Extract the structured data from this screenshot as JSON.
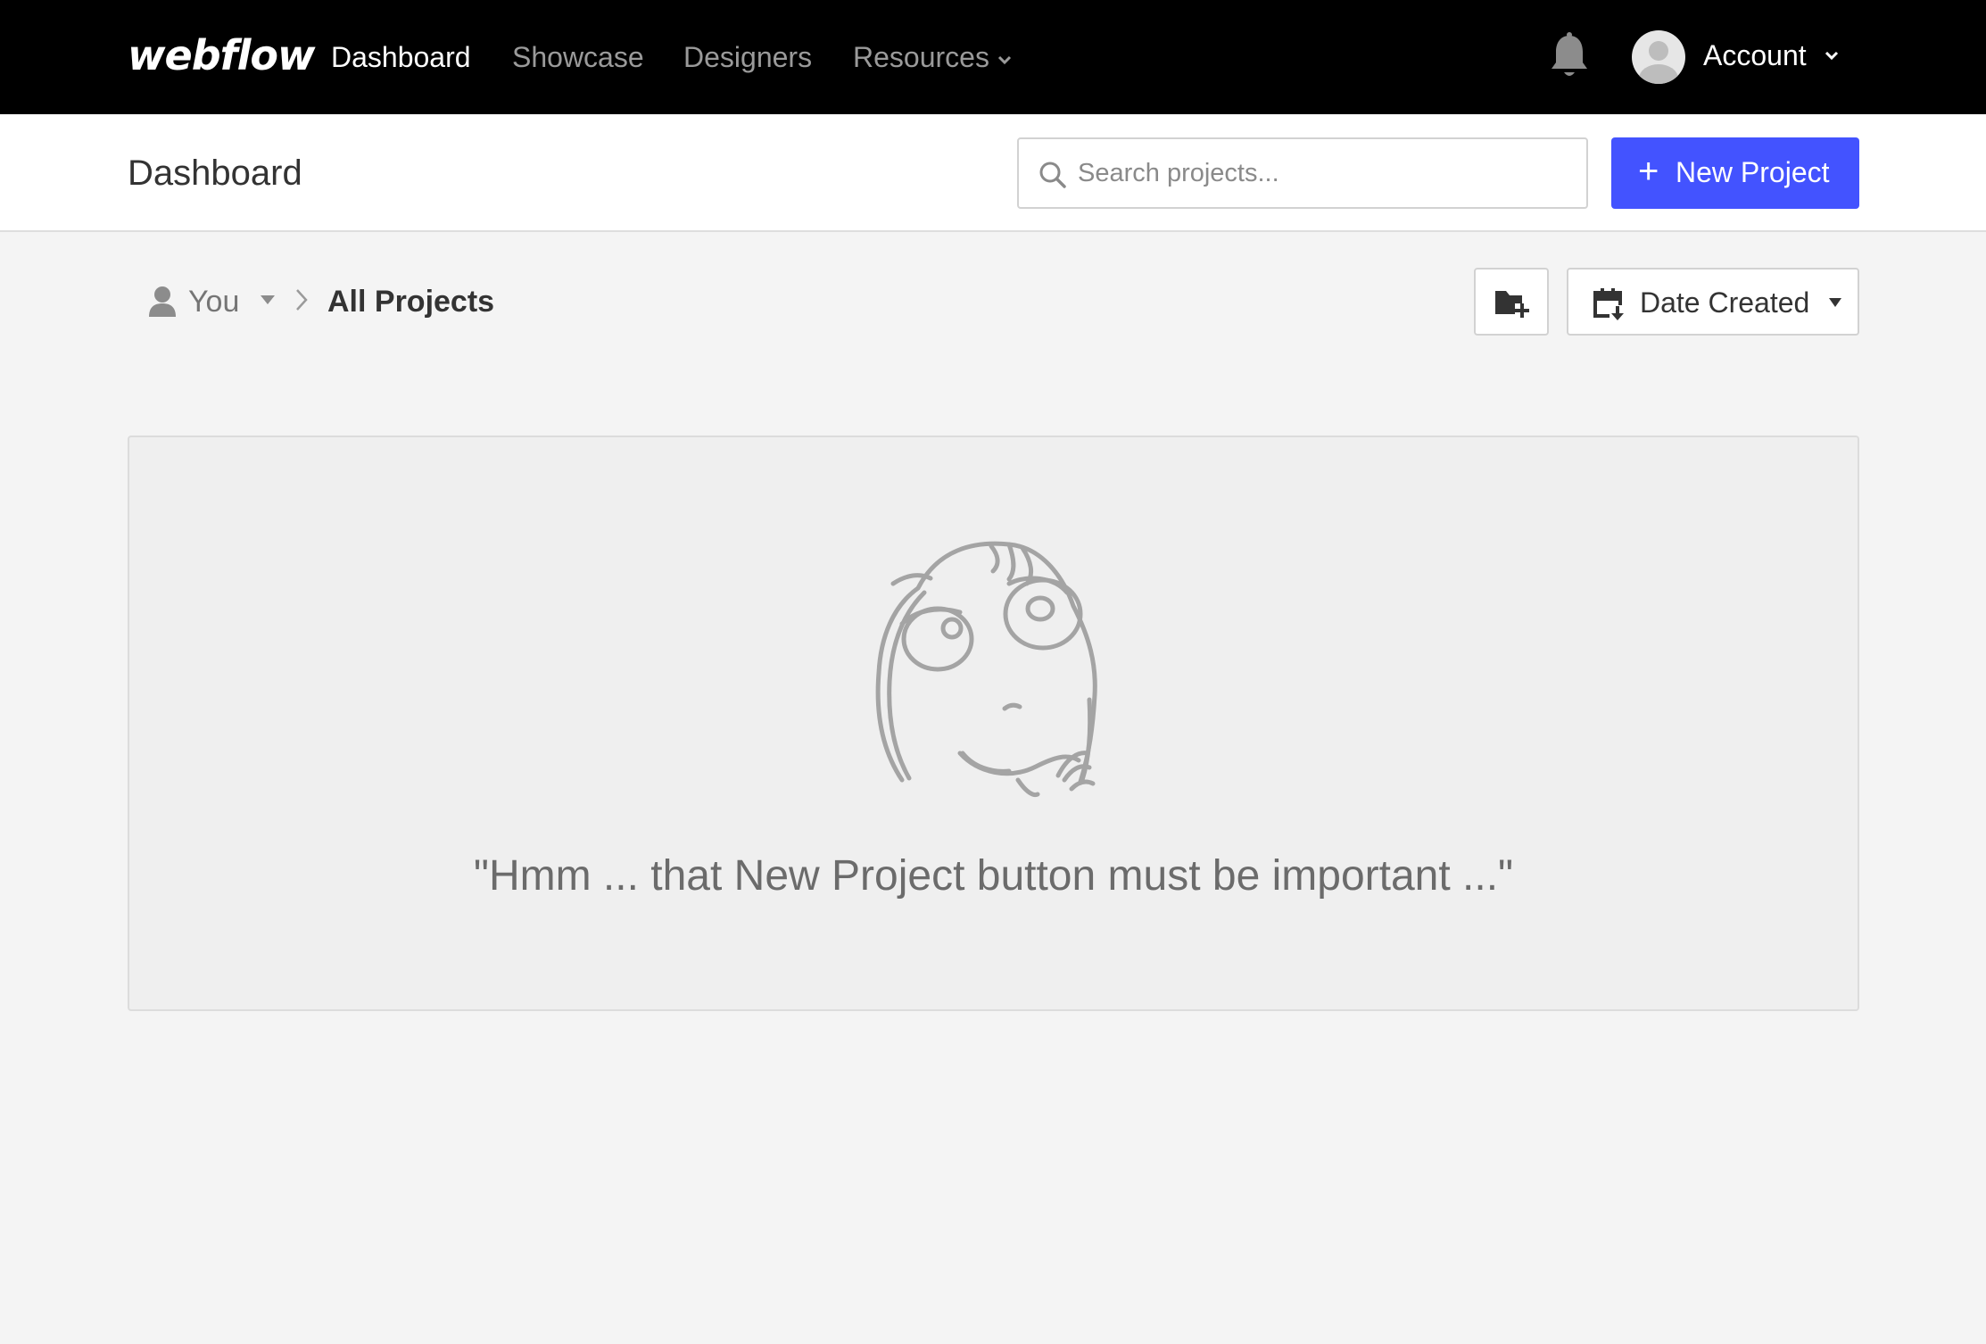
{
  "nav": {
    "logo": "webflow",
    "links": [
      "Dashboard",
      "Showcase",
      "Designers",
      "Resources"
    ],
    "active": "Dashboard",
    "account_label": "Account"
  },
  "header": {
    "title": "Dashboard",
    "search_placeholder": "Search projects...",
    "new_project_label": "New Project"
  },
  "toolbar": {
    "breadcrumb_owner": "You",
    "breadcrumb_current": "All Projects",
    "sort_label": "Date Created"
  },
  "empty_state": {
    "message": "\"Hmm ... that New Project button must be important ...\""
  },
  "colors": {
    "nav_bg": "#000000",
    "accent": "#4353ff",
    "page_bg": "#f4f4f4"
  },
  "icons": {
    "bell": "bell-icon",
    "search": "search-icon",
    "user": "user-icon",
    "new_folder": "folder-plus-icon",
    "calendar": "calendar-sort-icon"
  }
}
